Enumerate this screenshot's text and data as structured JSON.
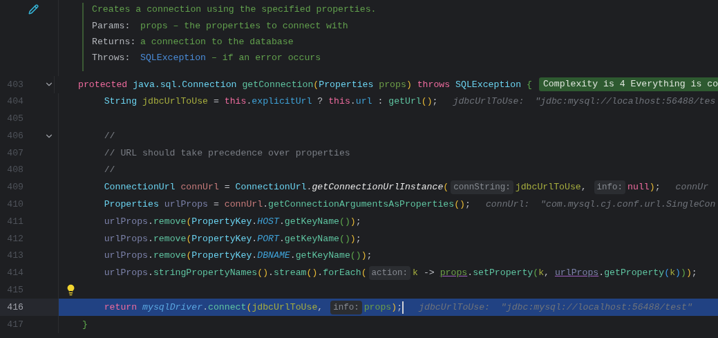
{
  "doc": {
    "summary": "Creates a connection using the specified properties.",
    "tags": [
      {
        "label": "Params:",
        "text": "props – the properties to connect with"
      },
      {
        "label": "Returns:",
        "text": "a connection to the database"
      },
      {
        "label": "Throws:",
        "ref": "SQLException",
        "text": "– if an error occurs"
      }
    ]
  },
  "lines": [
    {
      "number": "403",
      "kind": "fold",
      "selected": false,
      "segments": [
        {
          "kind": "code",
          "tokens": [
            {
              "kind": "kw",
              "text": "protected "
            },
            {
              "kind": "type",
              "text": "java.sql.Connection "
            },
            {
              "kind": "method",
              "text": "getConnection"
            },
            {
              "kind": "paren",
              "text": "("
            },
            {
              "kind": "type",
              "text": "Properties "
            },
            {
              "kind": "param",
              "text": "props"
            },
            {
              "kind": "paren",
              "text": ") "
            },
            {
              "kind": "kw",
              "text": "throws "
            },
            {
              "kind": "type",
              "text": "SQLException "
            },
            {
              "kind": "paren2",
              "text": "{"
            }
          ]
        },
        {
          "kind": "badge",
          "text": "Complexity is 4 Everything is co"
        }
      ]
    },
    {
      "number": "404",
      "selected": false,
      "segments": [
        {
          "kind": "code",
          "tokens": [
            {
              "kind": "type",
              "text": "    String "
            },
            {
              "kind": "local",
              "text": "jdbcUrlToUse"
            },
            {
              "kind": "plain",
              "text": " = "
            },
            {
              "kind": "kw",
              "text": "this"
            },
            {
              "kind": "plain",
              "text": "."
            },
            {
              "kind": "field",
              "text": "explicitUrl"
            },
            {
              "kind": "plain",
              "text": " ? "
            },
            {
              "kind": "kw",
              "text": "this"
            },
            {
              "kind": "plain",
              "text": "."
            },
            {
              "kind": "field",
              "text": "url"
            },
            {
              "kind": "plain",
              "text": " : "
            },
            {
              "kind": "method",
              "text": "getUrl"
            },
            {
              "kind": "paren",
              "text": "()"
            },
            {
              "kind": "plain",
              "text": ";"
            }
          ]
        },
        {
          "kind": "value_hint",
          "text": "jdbcUrlToUse:  \"jdbc:mysql://localhost:56488/tes"
        }
      ]
    },
    {
      "number": "405",
      "selected": false
    },
    {
      "number": "406",
      "kind": "fold",
      "selected": false,
      "segments": [
        {
          "kind": "code",
          "tokens": [
            {
              "kind": "comment",
              "text": "    //"
            }
          ]
        }
      ]
    },
    {
      "number": "407",
      "selected": false,
      "segments": [
        {
          "kind": "code",
          "tokens": [
            {
              "kind": "comment",
              "text": "    // URL should take precedence over properties"
            }
          ]
        }
      ]
    },
    {
      "number": "408",
      "selected": false,
      "segments": [
        {
          "kind": "code",
          "tokens": [
            {
              "kind": "comment",
              "text": "    //"
            }
          ]
        }
      ]
    },
    {
      "number": "409",
      "selected": false,
      "segments": [
        {
          "kind": "code",
          "tokens": [
            {
              "kind": "type",
              "text": "    ConnectionUrl "
            },
            {
              "kind": "var",
              "text": "connUrl"
            },
            {
              "kind": "plain",
              "text": " = "
            },
            {
              "kind": "type",
              "text": "ConnectionUrl"
            },
            {
              "kind": "plain",
              "text": "."
            },
            {
              "kind": "static",
              "text": "getConnectionUrlInstance"
            },
            {
              "kind": "paren",
              "text": "("
            }
          ]
        },
        {
          "kind": "inlay",
          "text": "connString:"
        },
        {
          "kind": "code",
          "tokens": [
            {
              "kind": "local",
              "text": "jdbcUrlToUse"
            },
            {
              "kind": "plain",
              "text": ", "
            }
          ]
        },
        {
          "kind": "inlay",
          "text": "info:"
        },
        {
          "kind": "code",
          "tokens": [
            {
              "kind": "kw",
              "text": "null"
            },
            {
              "kind": "paren",
              "text": ")"
            },
            {
              "kind": "plain",
              "text": ";"
            }
          ]
        },
        {
          "kind": "value_hint",
          "text": "connUr"
        }
      ]
    },
    {
      "number": "410",
      "selected": false,
      "segments": [
        {
          "kind": "code",
          "tokens": [
            {
              "kind": "type",
              "text": "    Properties "
            },
            {
              "kind": "muted",
              "text": "urlProps"
            },
            {
              "kind": "plain",
              "text": " = "
            },
            {
              "kind": "var",
              "text": "connUrl"
            },
            {
              "kind": "plain",
              "text": "."
            },
            {
              "kind": "method",
              "text": "getConnectionArgumentsAsProperties"
            },
            {
              "kind": "paren",
              "text": "()"
            },
            {
              "kind": "plain",
              "text": ";"
            }
          ]
        },
        {
          "kind": "value_hint",
          "text": "connUrl:  \"com.mysql.cj.conf.url.SingleCon"
        }
      ]
    },
    {
      "number": "411",
      "selected": false,
      "segments": [
        {
          "kind": "code",
          "tokens": [
            {
              "kind": "muted",
              "text": "    urlProps"
            },
            {
              "kind": "plain",
              "text": "."
            },
            {
              "kind": "method",
              "text": "remove"
            },
            {
              "kind": "paren",
              "text": "("
            },
            {
              "kind": "type",
              "text": "PropertyKey"
            },
            {
              "kind": "plain",
              "text": "."
            },
            {
              "kind": "const",
              "text": "HOST"
            },
            {
              "kind": "plain",
              "text": "."
            },
            {
              "kind": "method",
              "text": "getKeyName"
            },
            {
              "kind": "paren2",
              "text": "()"
            },
            {
              "kind": "paren",
              "text": ")"
            },
            {
              "kind": "plain",
              "text": ";"
            }
          ]
        }
      ]
    },
    {
      "number": "412",
      "selected": false,
      "segments": [
        {
          "kind": "code",
          "tokens": [
            {
              "kind": "muted",
              "text": "    urlProps"
            },
            {
              "kind": "plain",
              "text": "."
            },
            {
              "kind": "method",
              "text": "remove"
            },
            {
              "kind": "paren",
              "text": "("
            },
            {
              "kind": "type",
              "text": "PropertyKey"
            },
            {
              "kind": "plain",
              "text": "."
            },
            {
              "kind": "const",
              "text": "PORT"
            },
            {
              "kind": "plain",
              "text": "."
            },
            {
              "kind": "method",
              "text": "getKeyName"
            },
            {
              "kind": "paren2",
              "text": "()"
            },
            {
              "kind": "paren",
              "text": ")"
            },
            {
              "kind": "plain",
              "text": ";"
            }
          ]
        }
      ]
    },
    {
      "number": "413",
      "selected": false,
      "segments": [
        {
          "kind": "code",
          "tokens": [
            {
              "kind": "muted",
              "text": "    urlProps"
            },
            {
              "kind": "plain",
              "text": "."
            },
            {
              "kind": "method",
              "text": "remove"
            },
            {
              "kind": "paren",
              "text": "("
            },
            {
              "kind": "type",
              "text": "PropertyKey"
            },
            {
              "kind": "plain",
              "text": "."
            },
            {
              "kind": "const",
              "text": "DBNAME"
            },
            {
              "kind": "plain",
              "text": "."
            },
            {
              "kind": "method",
              "text": "getKeyName"
            },
            {
              "kind": "paren2",
              "text": "()"
            },
            {
              "kind": "paren",
              "text": ")"
            },
            {
              "kind": "plain",
              "text": ";"
            }
          ]
        }
      ]
    },
    {
      "number": "414",
      "selected": false,
      "segments": [
        {
          "kind": "code",
          "tokens": [
            {
              "kind": "muted",
              "text": "    urlProps"
            },
            {
              "kind": "plain",
              "text": "."
            },
            {
              "kind": "method",
              "text": "stringPropertyNames"
            },
            {
              "kind": "paren",
              "text": "()"
            },
            {
              "kind": "plain",
              "text": "."
            },
            {
              "kind": "method",
              "text": "stream"
            },
            {
              "kind": "paren",
              "text": "()"
            },
            {
              "kind": "plain",
              "text": "."
            },
            {
              "kind": "method",
              "text": "forEach"
            },
            {
              "kind": "paren",
              "text": "("
            }
          ]
        },
        {
          "kind": "inlay",
          "text": "action:"
        },
        {
          "kind": "code",
          "tokens": [
            {
              "kind": "local",
              "text": "k"
            },
            {
              "kind": "plain",
              "text": " -> "
            },
            {
              "kind": "param_ref",
              "text": "props"
            },
            {
              "kind": "plain",
              "text": "."
            },
            {
              "kind": "method",
              "text": "setProperty"
            },
            {
              "kind": "paren2",
              "text": "("
            },
            {
              "kind": "local",
              "text": "k"
            },
            {
              "kind": "plain",
              "text": ", "
            },
            {
              "kind": "var_ref",
              "text": "urlProps"
            },
            {
              "kind": "plain",
              "text": "."
            },
            {
              "kind": "method",
              "text": "getProperty"
            },
            {
              "kind": "paren3",
              "text": "("
            },
            {
              "kind": "local",
              "text": "k"
            },
            {
              "kind": "paren3",
              "text": ")"
            },
            {
              "kind": "paren2",
              "text": ")"
            },
            {
              "kind": "paren",
              "text": ")"
            },
            {
              "kind": "plain",
              "text": ";"
            }
          ]
        }
      ]
    },
    {
      "number": "415",
      "kind": "bulb",
      "selected": false
    },
    {
      "number": "416",
      "selected": true,
      "segments": [
        {
          "kind": "code",
          "tokens": [
            {
              "kind": "kw",
              "text": "    return "
            },
            {
              "kind": "driver",
              "text": "mysqlDriver"
            },
            {
              "kind": "plain",
              "text": "."
            },
            {
              "kind": "method",
              "text": "connect"
            },
            {
              "kind": "paren",
              "text": "("
            },
            {
              "kind": "local",
              "text": "jdbcUrlToUse"
            },
            {
              "kind": "plain",
              "text": ", "
            }
          ]
        },
        {
          "kind": "inlay",
          "text": "info:"
        },
        {
          "kind": "code",
          "tokens": [
            {
              "kind": "param",
              "text": "props"
            },
            {
              "kind": "paren",
              "text": ")"
            },
            {
              "kind": "plain",
              "text": ";"
            }
          ]
        },
        {
          "kind": "caret"
        },
        {
          "kind": "value_hint",
          "text": "jdbcUrlToUse:  \"jdbc:mysql://localhost:56488/test\""
        }
      ]
    },
    {
      "number": "417",
      "selected": false,
      "segments": [
        {
          "kind": "code",
          "tokens": [
            {
              "kind": "paren2",
              "text": "}"
            }
          ]
        }
      ]
    }
  ]
}
